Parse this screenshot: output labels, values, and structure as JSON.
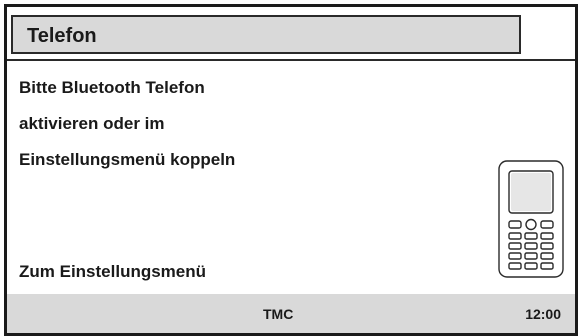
{
  "header": {
    "title": "Telefon"
  },
  "message": {
    "lines": [
      "Bitte Bluetooth Telefon",
      "aktivieren oder im",
      "Einstellungsmenü koppeln"
    ]
  },
  "actions": {
    "settings_label": "Zum Einstellungsmenü"
  },
  "graphic": {
    "icon": "mobile-phone-icon"
  },
  "status": {
    "tmc": "TMC",
    "clock": "12:00"
  }
}
